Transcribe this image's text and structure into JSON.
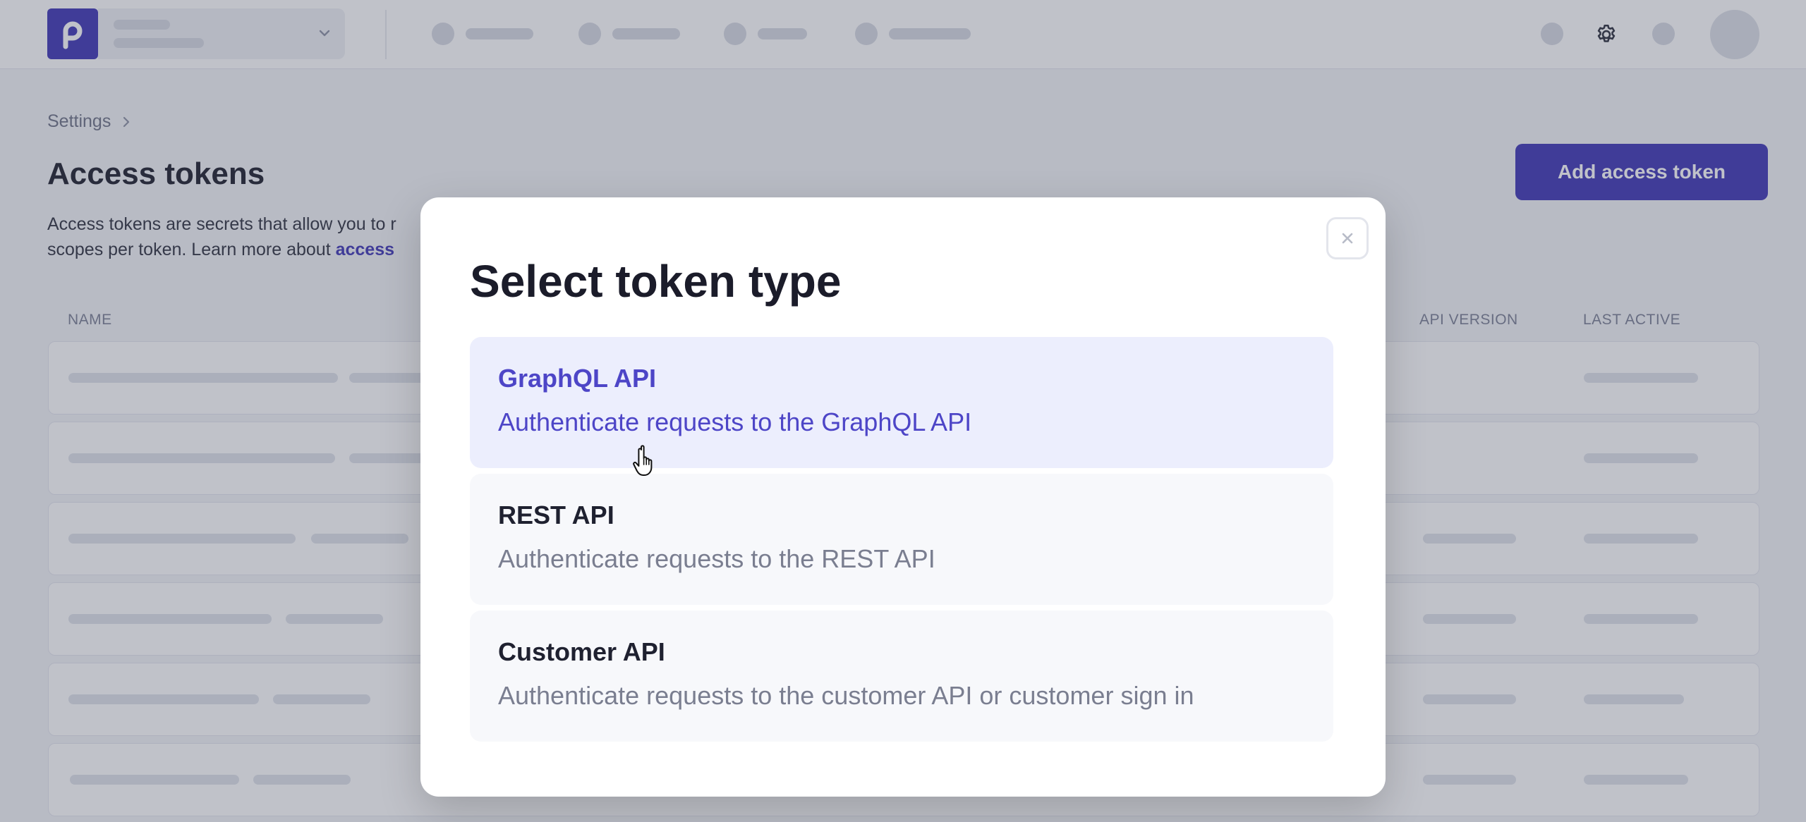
{
  "breadcrumb": {
    "parent": "Settings"
  },
  "page": {
    "title": "Access tokens",
    "description_line1": "Access tokens are secrets that allow you to r",
    "description_line2_prefix": "scopes per token. Learn more about ",
    "description_link": "access"
  },
  "actions": {
    "add_token_label": "Add access token"
  },
  "table": {
    "columns": [
      "NAME",
      "API VERSION",
      "LAST ACTIVE"
    ]
  },
  "modal": {
    "title": "Select token type",
    "options": [
      {
        "title": "GraphQL API",
        "description": "Authenticate requests to the GraphQL API",
        "selected": true
      },
      {
        "title": "REST API",
        "description": "Authenticate requests to the REST API",
        "selected": false
      },
      {
        "title": "Customer API",
        "description": "Authenticate requests to the customer API or customer sign in",
        "selected": false
      }
    ]
  },
  "colors": {
    "brand": "#3d34b5",
    "selected_option_bg": "#eceefd",
    "selected_option_text": "#4d45c7"
  },
  "icons": {
    "logo": "brand-p-logo",
    "org_switcher": "chevron-down-icon",
    "breadcrumb_separator": "chevron-right-icon",
    "settings": "gear-icon",
    "modal_close": "close-icon",
    "pointer": "hand-cursor-icon"
  }
}
